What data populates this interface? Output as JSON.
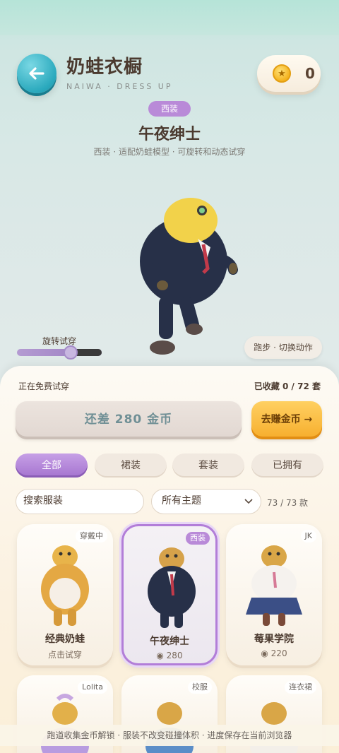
{
  "header": {
    "title": "奶蛙衣橱",
    "subtitle": "NAIWA · DRESS UP",
    "coins": "0"
  },
  "preview": {
    "tag": "西装",
    "name": "午夜绅士",
    "description": "西装 · 适配奶蛙模型 · 可旋转和动态试穿",
    "rotate_label": "旋转试穿",
    "rotate_level": 0.6,
    "action_label": "跑步 · 切换动作"
  },
  "panel": {
    "trying_label": "正在免费试穿",
    "collected_label": "已收藏 0 / 72 套",
    "short_label": "还差 280 金币",
    "earn_label": "去赚金币 →",
    "filters": [
      "全部",
      "裙装",
      "套装",
      "已拥有"
    ],
    "search_placeholder": "搜索服装",
    "theme_value": "所有主题",
    "count_label": "73 / 73 款"
  },
  "cards": [
    {
      "badge": "穿戴中",
      "name": "经典奶蛙",
      "sub": "点击试穿"
    },
    {
      "badge": "西装",
      "name": "午夜绅士",
      "sub": "◉ 280"
    },
    {
      "badge": "JK",
      "name": "莓果学院",
      "sub": "◉ 220"
    }
  ],
  "cards_row2": [
    {
      "badge": "Lolita"
    },
    {
      "badge": "校服"
    },
    {
      "badge": "连衣裙"
    }
  ],
  "footer": "跑道收集金币解锁 · 服装不改变碰撞体积 · 进度保存在当前浏览器",
  "colors": {
    "accent_purple": "#b98ad8",
    "earn_orange": "#f6ad2c",
    "back_teal": "#2aa9bd"
  }
}
